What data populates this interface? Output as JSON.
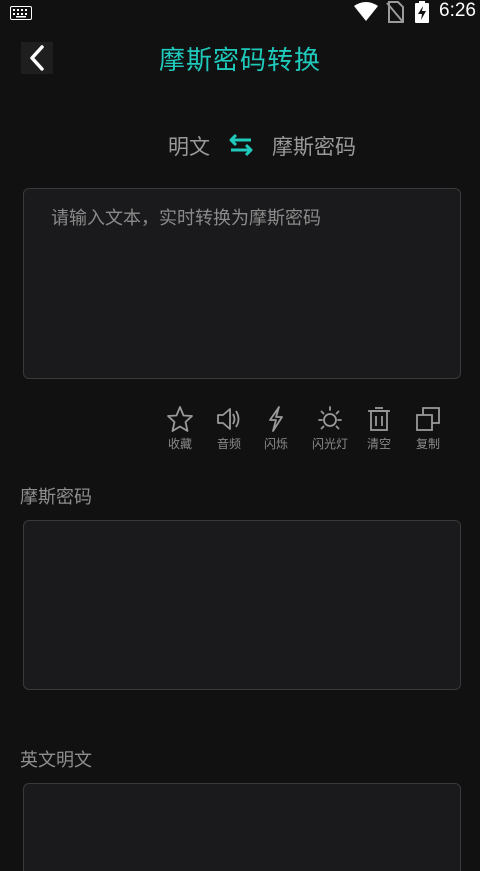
{
  "status_bar": {
    "time": "6:26"
  },
  "header": {
    "title": "摩斯密码转换"
  },
  "mode": {
    "source": "明文",
    "target": "摩斯密码"
  },
  "input": {
    "placeholder": "请输入文本，实时转换为摩斯密码",
    "value": ""
  },
  "tools": [
    {
      "label": "收藏",
      "icon": "star-icon"
    },
    {
      "label": "音频",
      "icon": "speaker-icon"
    },
    {
      "label": "闪烁",
      "icon": "lightning-icon"
    },
    {
      "label": "闪光灯",
      "icon": "sun-icon"
    },
    {
      "label": "清空",
      "icon": "trash-icon"
    },
    {
      "label": "复制",
      "icon": "copy-icon"
    }
  ],
  "morse_output": {
    "label": "摩斯密码",
    "value": ""
  },
  "english_output": {
    "label": "英文明文",
    "value": ""
  },
  "colors": {
    "accent": "#1fc9bb",
    "background": "#111111",
    "box": "#1a1a1c"
  }
}
